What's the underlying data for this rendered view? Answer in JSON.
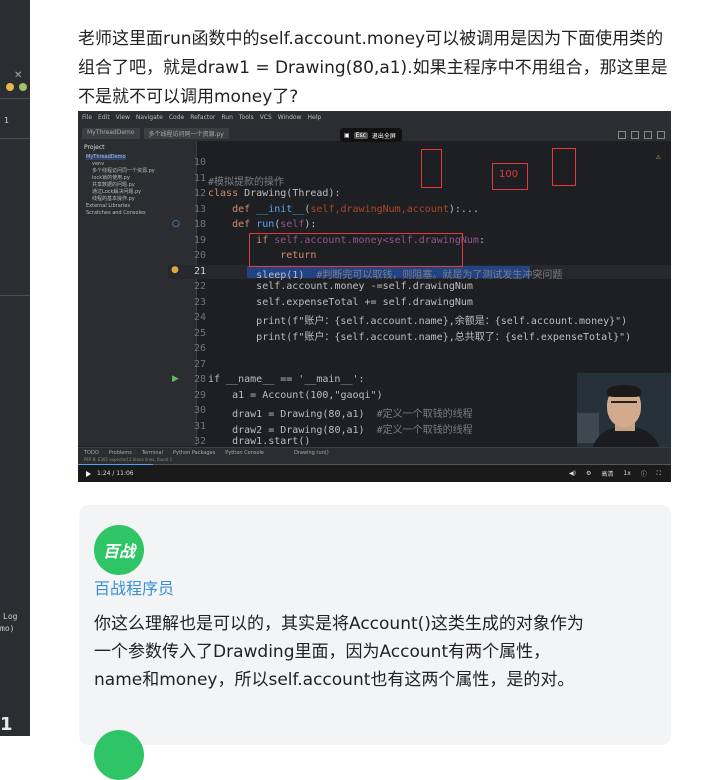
{
  "question": {
    "text": "老师这里面run函数中的self.account.money可以被调用是因为下面使用类的组合了吧，就是draw1 = Drawing(80,a1).如果主程序中不用组合，那这里是不是就不可以调用money了?"
  },
  "video": {
    "ide": {
      "menu": [
        "File",
        "Edit",
        "View",
        "Navigate",
        "Code",
        "Refactor",
        "Run",
        "Tools",
        "VCS",
        "Window",
        "Help"
      ],
      "project_tab": "MyThreadDemo",
      "file_tab": "多个线程访问同一个资源.py",
      "sidebar_header": "Project",
      "sidebar_items": [
        "MyThreadDemo",
        "venv",
        "多个线程访问同一个资源.py",
        "lock锁的使用.py",
        "共享数据的问题.py",
        "通过Lock解决问题.py",
        "线程的基本操作.py",
        "External Libraries",
        "Scratches and Consoles"
      ],
      "bottom_tools": [
        "TODO",
        "Problems",
        "Terminal",
        "Python Packages",
        "Python Console"
      ],
      "statusbar": "PEP 8: E302 expected 2 blank lines, found 1",
      "breadcrumb": "Drawing  run()"
    },
    "recording": {
      "esc": "Esc",
      "label": "退出全屏"
    },
    "annotation_number": "100",
    "code": {
      "line_numbers": [
        "10",
        "11",
        "12",
        "13",
        "18",
        "19",
        "20",
        "21",
        "22",
        "23",
        "24",
        "25",
        "26",
        "27",
        "28",
        "29",
        "30",
        "31",
        "32"
      ],
      "current_line": "21",
      "comment1": "#模拟提款的操作",
      "class_name": "Drawing",
      "base": "Thread",
      "init_sig": "__init__",
      "init_params": "self,drawingNum,account",
      "run_name": "run",
      "if_cond": "self.account.money<self.drawingNum",
      "return_kw": "return",
      "sleep_call": "sleep(1)",
      "sleep_comment": "#判断完可以取钱，则阻塞。就是为了测试发生冲突问题",
      "line22": "self.account.money -=self.drawingNum",
      "line23": "self.expenseTotal += self.drawingNum",
      "line24": "print(f\"账户：{self.account.name},余额是：{self.account.money}\")",
      "line25": "print(f\"账户：{self.account.name},总共取了：{self.expenseTotal}\")",
      "main_guard": "if __name__ == '__main__':",
      "line29": "a1 = Account(100,\"gaoqi\")",
      "line30_code": "draw1 = Drawing(80,a1)",
      "line30_comment": "#定义一个取钱的线程",
      "line31_code": "draw2 = Drawing(80,a1)",
      "line31_comment": "#定义一个取钱的线程",
      "line32": "draw1.start()"
    },
    "player": {
      "time": "1:24 / 11:06",
      "progress": 0.126,
      "quality": "高清",
      "speed": "1x"
    }
  },
  "answer": {
    "avatar_text": "百战",
    "author": "百战程序员",
    "text": "你这么理解也是可以的，其实是将Account()这类生成的对象作为一个参数传入了Drawding里面，因为Account有两个属性，name和money，所以self.account也有这两个属性，是的对。"
  },
  "leftbar": {
    "items": [
      "1",
      "Log",
      "mo)"
    ]
  }
}
